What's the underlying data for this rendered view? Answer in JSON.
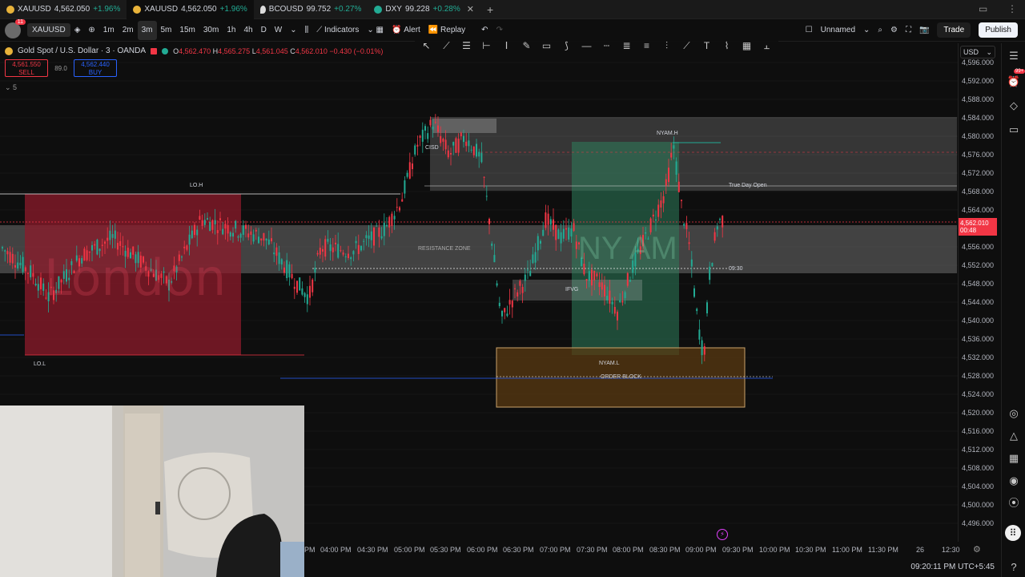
{
  "tabs": [
    {
      "symbol": "XAUUSD",
      "price": "4,562.050",
      "change": "+1.96%",
      "active": false
    },
    {
      "symbol": "XAUUSD",
      "price": "4,562.050",
      "change": "+1.96%",
      "active": true
    },
    {
      "symbol": "BCOUSD",
      "price": "99.752",
      "change": "+0.27%",
      "active": false
    },
    {
      "symbol": "DXY",
      "price": "99.228",
      "change": "+0.28%",
      "active": false
    }
  ],
  "toolbar": {
    "avatar_badge": "11",
    "symbol": "XAUUSD",
    "intervals": [
      "1m",
      "2m",
      "3m",
      "5m",
      "15m",
      "30m",
      "1h",
      "4h",
      "D",
      "W"
    ],
    "active_interval": "3m",
    "indicators_label": "Indicators",
    "alert_label": "Alert",
    "replay_label": "Replay",
    "layout_name": "Unnamed",
    "trade_label": "Trade",
    "publish_label": "Publish"
  },
  "legend": {
    "title": "Gold Spot / U.S. Dollar · 3 · OANDA",
    "o_label": "O",
    "o": "4,562.470",
    "h_label": "H",
    "h": "4,565.275",
    "l_label": "L",
    "l": "4,561.045",
    "c_label": "C",
    "c": "4,562.010",
    "change": "−0.430 (−0.01%)",
    "sell_price": "4,561.550",
    "sell_label": "SELL",
    "spread": "89.0",
    "buy_price": "4,562.440",
    "buy_label": "BUY",
    "volume_indicator": "5"
  },
  "annotations": {
    "london_label": "London",
    "lo_h": "LO.H",
    "lo_l": "LO.L",
    "cisd": "CISD",
    "nyam_h": "NYAM.H",
    "nyam_l": "NYAM.L",
    "nyam_label": "NY AM",
    "true_day_open": "True Day Open",
    "resistance_zone": "RESISTANCE ZONE",
    "ifvg": "IFVG",
    "order_block": "ORDER BLOCK",
    "time_0930": "09:30"
  },
  "price_axis": {
    "currency": "USD",
    "labels": [
      "4,596.000",
      "4,592.000",
      "4,588.000",
      "4,584.000",
      "4,580.000",
      "4,576.000",
      "4,572.000",
      "4,568.000",
      "4,564.000",
      "4,560.000",
      "4,556.000",
      "4,552.000",
      "4,548.000",
      "4,544.000",
      "4,540.000",
      "4,536.000",
      "4,532.000",
      "4,528.000",
      "4,524.000",
      "4,520.000",
      "4,516.000",
      "4,512.000",
      "4,508.000",
      "4,504.000",
      "4,500.000",
      "4,496.000"
    ],
    "current_price": "4,562.010",
    "countdown": "00:48"
  },
  "time_axis": {
    "labels": [
      "PM",
      "04:00 PM",
      "04:30 PM",
      "05:00 PM",
      "05:30 PM",
      "06:00 PM",
      "06:30 PM",
      "07:00 PM",
      "07:30 PM",
      "08:00 PM",
      "08:30 PM",
      "09:00 PM",
      "09:30 PM",
      "10:00 PM",
      "10:30 PM",
      "11:00 PM",
      "11:30 PM",
      "26",
      "12:30"
    ]
  },
  "status": {
    "clock": "09:20:11 PM UTC+5:45"
  },
  "colors": {
    "up": "#22ab94",
    "down": "#f23645",
    "london_box": "#8e1b2b",
    "nyam_box": "#2e7d5b",
    "order_block": "#5a3a12"
  }
}
